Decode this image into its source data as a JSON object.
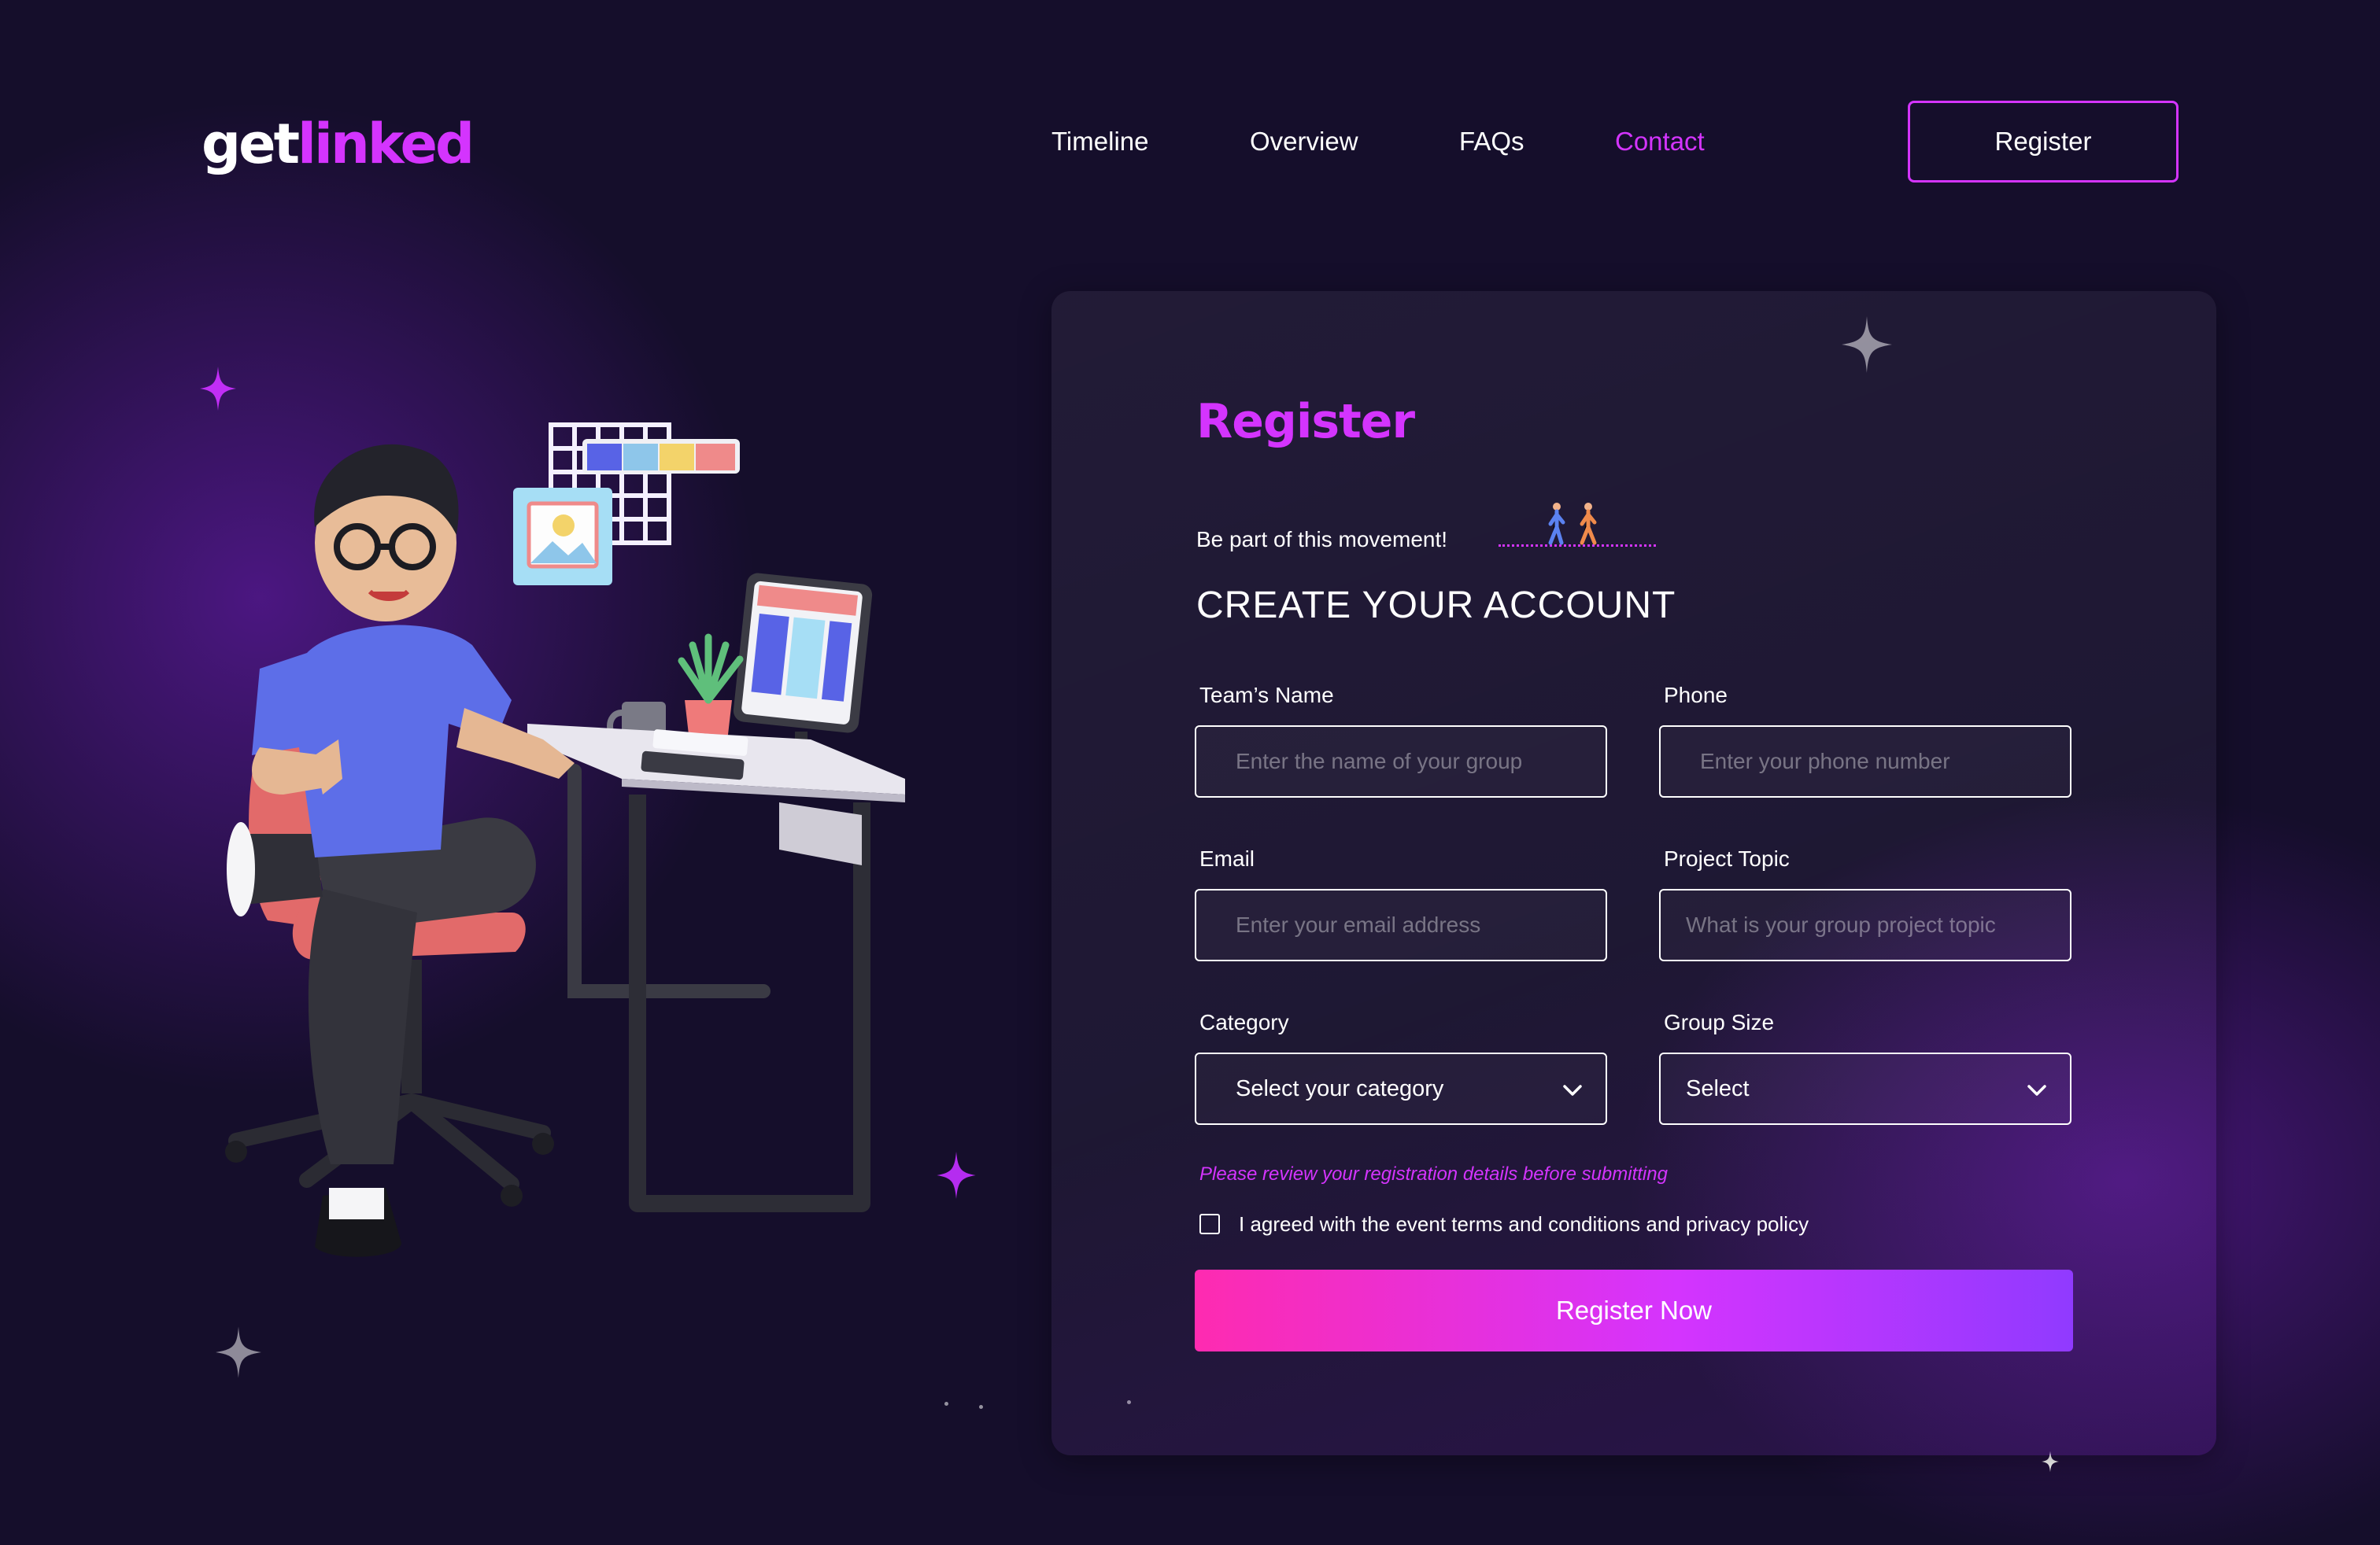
{
  "brand": {
    "logo_part1": "get",
    "logo_part2": "linked"
  },
  "nav": {
    "items": [
      {
        "label": "Timeline"
      },
      {
        "label": "Overview"
      },
      {
        "label": "FAQs"
      },
      {
        "label": "Contact",
        "active": true
      }
    ],
    "register_label": "Register"
  },
  "form": {
    "title": "Register",
    "tagline": "Be part of this movement!",
    "heading": "CREATE YOUR ACCOUNT",
    "fields": {
      "team_name": {
        "label": "Team’s Name",
        "placeholder": "Enter the name of your group"
      },
      "phone": {
        "label": "Phone",
        "placeholder": "Enter your phone number"
      },
      "email": {
        "label": "Email",
        "placeholder": "Enter your email address"
      },
      "project_topic": {
        "label": "Project Topic",
        "placeholder": "What is your group project topic"
      },
      "category": {
        "label": "Category",
        "value": "Select your category"
      },
      "group_size": {
        "label": "Group Size",
        "value": "Select"
      }
    },
    "note": "Please review your registration details before submitting",
    "agree_text": "I agreed with the event terms and conditions  and privacy policy",
    "submit_label": "Register Now"
  },
  "colors": {
    "background": "#150e2b",
    "accent": "#d434fe",
    "button_gradient": [
      "#fe2bb0",
      "#d434fe",
      "#903aff"
    ]
  },
  "icons": [
    "sparkle-icon",
    "chevron-down-icon",
    "walking-people-icon",
    "checkbox-icon"
  ]
}
